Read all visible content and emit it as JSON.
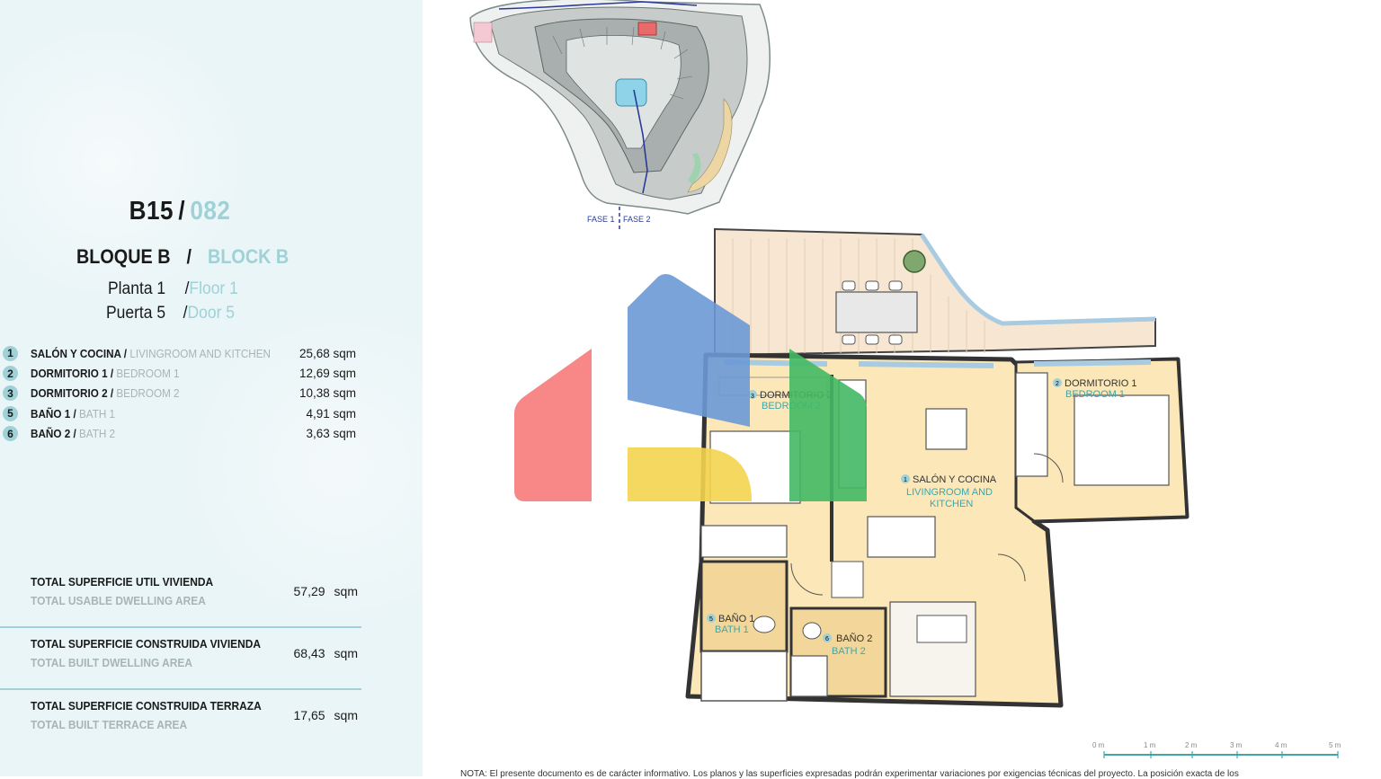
{
  "unit": {
    "code": "B15",
    "slash": "/",
    "number": "082"
  },
  "block": {
    "es_label": "BLOQUE B",
    "slash": "/",
    "en_label": "BLOCK B"
  },
  "floor": {
    "es": "Planta 1",
    "slash": "/",
    "en": "Floor 1"
  },
  "door": {
    "es": "Puerta 5",
    "slash": "/",
    "en": "Door 5"
  },
  "rooms": [
    {
      "num": "1",
      "es": "SALÓN Y COCINA /",
      "en": "LIVINGROOM AND KITCHEN",
      "area": "25,68 sqm"
    },
    {
      "num": "2",
      "es": "DORMITORIO 1 /",
      "en": "BEDROOM 1",
      "area": "12,69 sqm"
    },
    {
      "num": "3",
      "es": "DORMITORIO 2 /",
      "en": "BEDROOM 2",
      "area": "10,38 sqm"
    },
    {
      "num": "5",
      "es": "BAÑO 1 /",
      "en": "BATH 1",
      "area": "4,91 sqm"
    },
    {
      "num": "6",
      "es": "BAÑO 2 /",
      "en": "BATH 2",
      "area": "3,63 sqm"
    }
  ],
  "totals": [
    {
      "es": "TOTAL SUPERFICIE UTIL VIVIENDA",
      "en": "TOTAL USABLE DWELLING AREA",
      "value": "57,29",
      "unit": "sqm"
    },
    {
      "es": "TOTAL SUPERFICIE CONSTRUIDA VIVIENDA",
      "en": "TOTAL BUILT DWELLING AREA",
      "value": "68,43",
      "unit": "sqm"
    },
    {
      "es": "TOTAL SUPERFICIE CONSTRUIDA TERRAZA",
      "en": "TOTAL BUILT TERRACE AREA",
      "value": "17,65",
      "unit": "sqm"
    }
  ],
  "site_plan": {
    "fase1": "FASE 1",
    "fase2": "FASE 2"
  },
  "plan_labels": {
    "bed2_es": "DORMITORIO 2",
    "bed2_en": "BEDROOM 2",
    "bed2_num": "3",
    "bed1_es": "DORMITORIO 1",
    "bed1_en": "BEDROOM 1",
    "bed1_num": "2",
    "living_es": "SALÓN Y COCINA",
    "living_en1": "LIVINGROOM AND",
    "living_en2": "KITCHEN",
    "living_num": "1",
    "bath1_es": "BAÑO 1",
    "bath1_en": "BATH 1",
    "bath1_num": "5",
    "bath2_es": "BAÑO 2",
    "bath2_en": "BATH 2",
    "bath2_num": "6"
  },
  "scale": {
    "t0": "0 m",
    "t1": "1 m",
    "t2": "2 m",
    "t3": "3 m",
    "t4": "4 m",
    "t5": "5 m"
  },
  "note": "NOTA: El presente documento es de carácter informativo. Los planos y las superficies expresadas podrán experimentar variaciones por exigencias técnicas del proyecto. La posición exacta de los",
  "colors": {
    "panel_bg": "#eaf5f7",
    "accent": "#9fd1d6",
    "room_fill": "#fbe7b8",
    "bath_fill": "#f3d79a",
    "terrace": "#f6e6d2",
    "logo_red": "#f77b7b",
    "logo_blue": "#6c99d6",
    "logo_yellow": "#f4d44e",
    "logo_green": "#42b964"
  }
}
